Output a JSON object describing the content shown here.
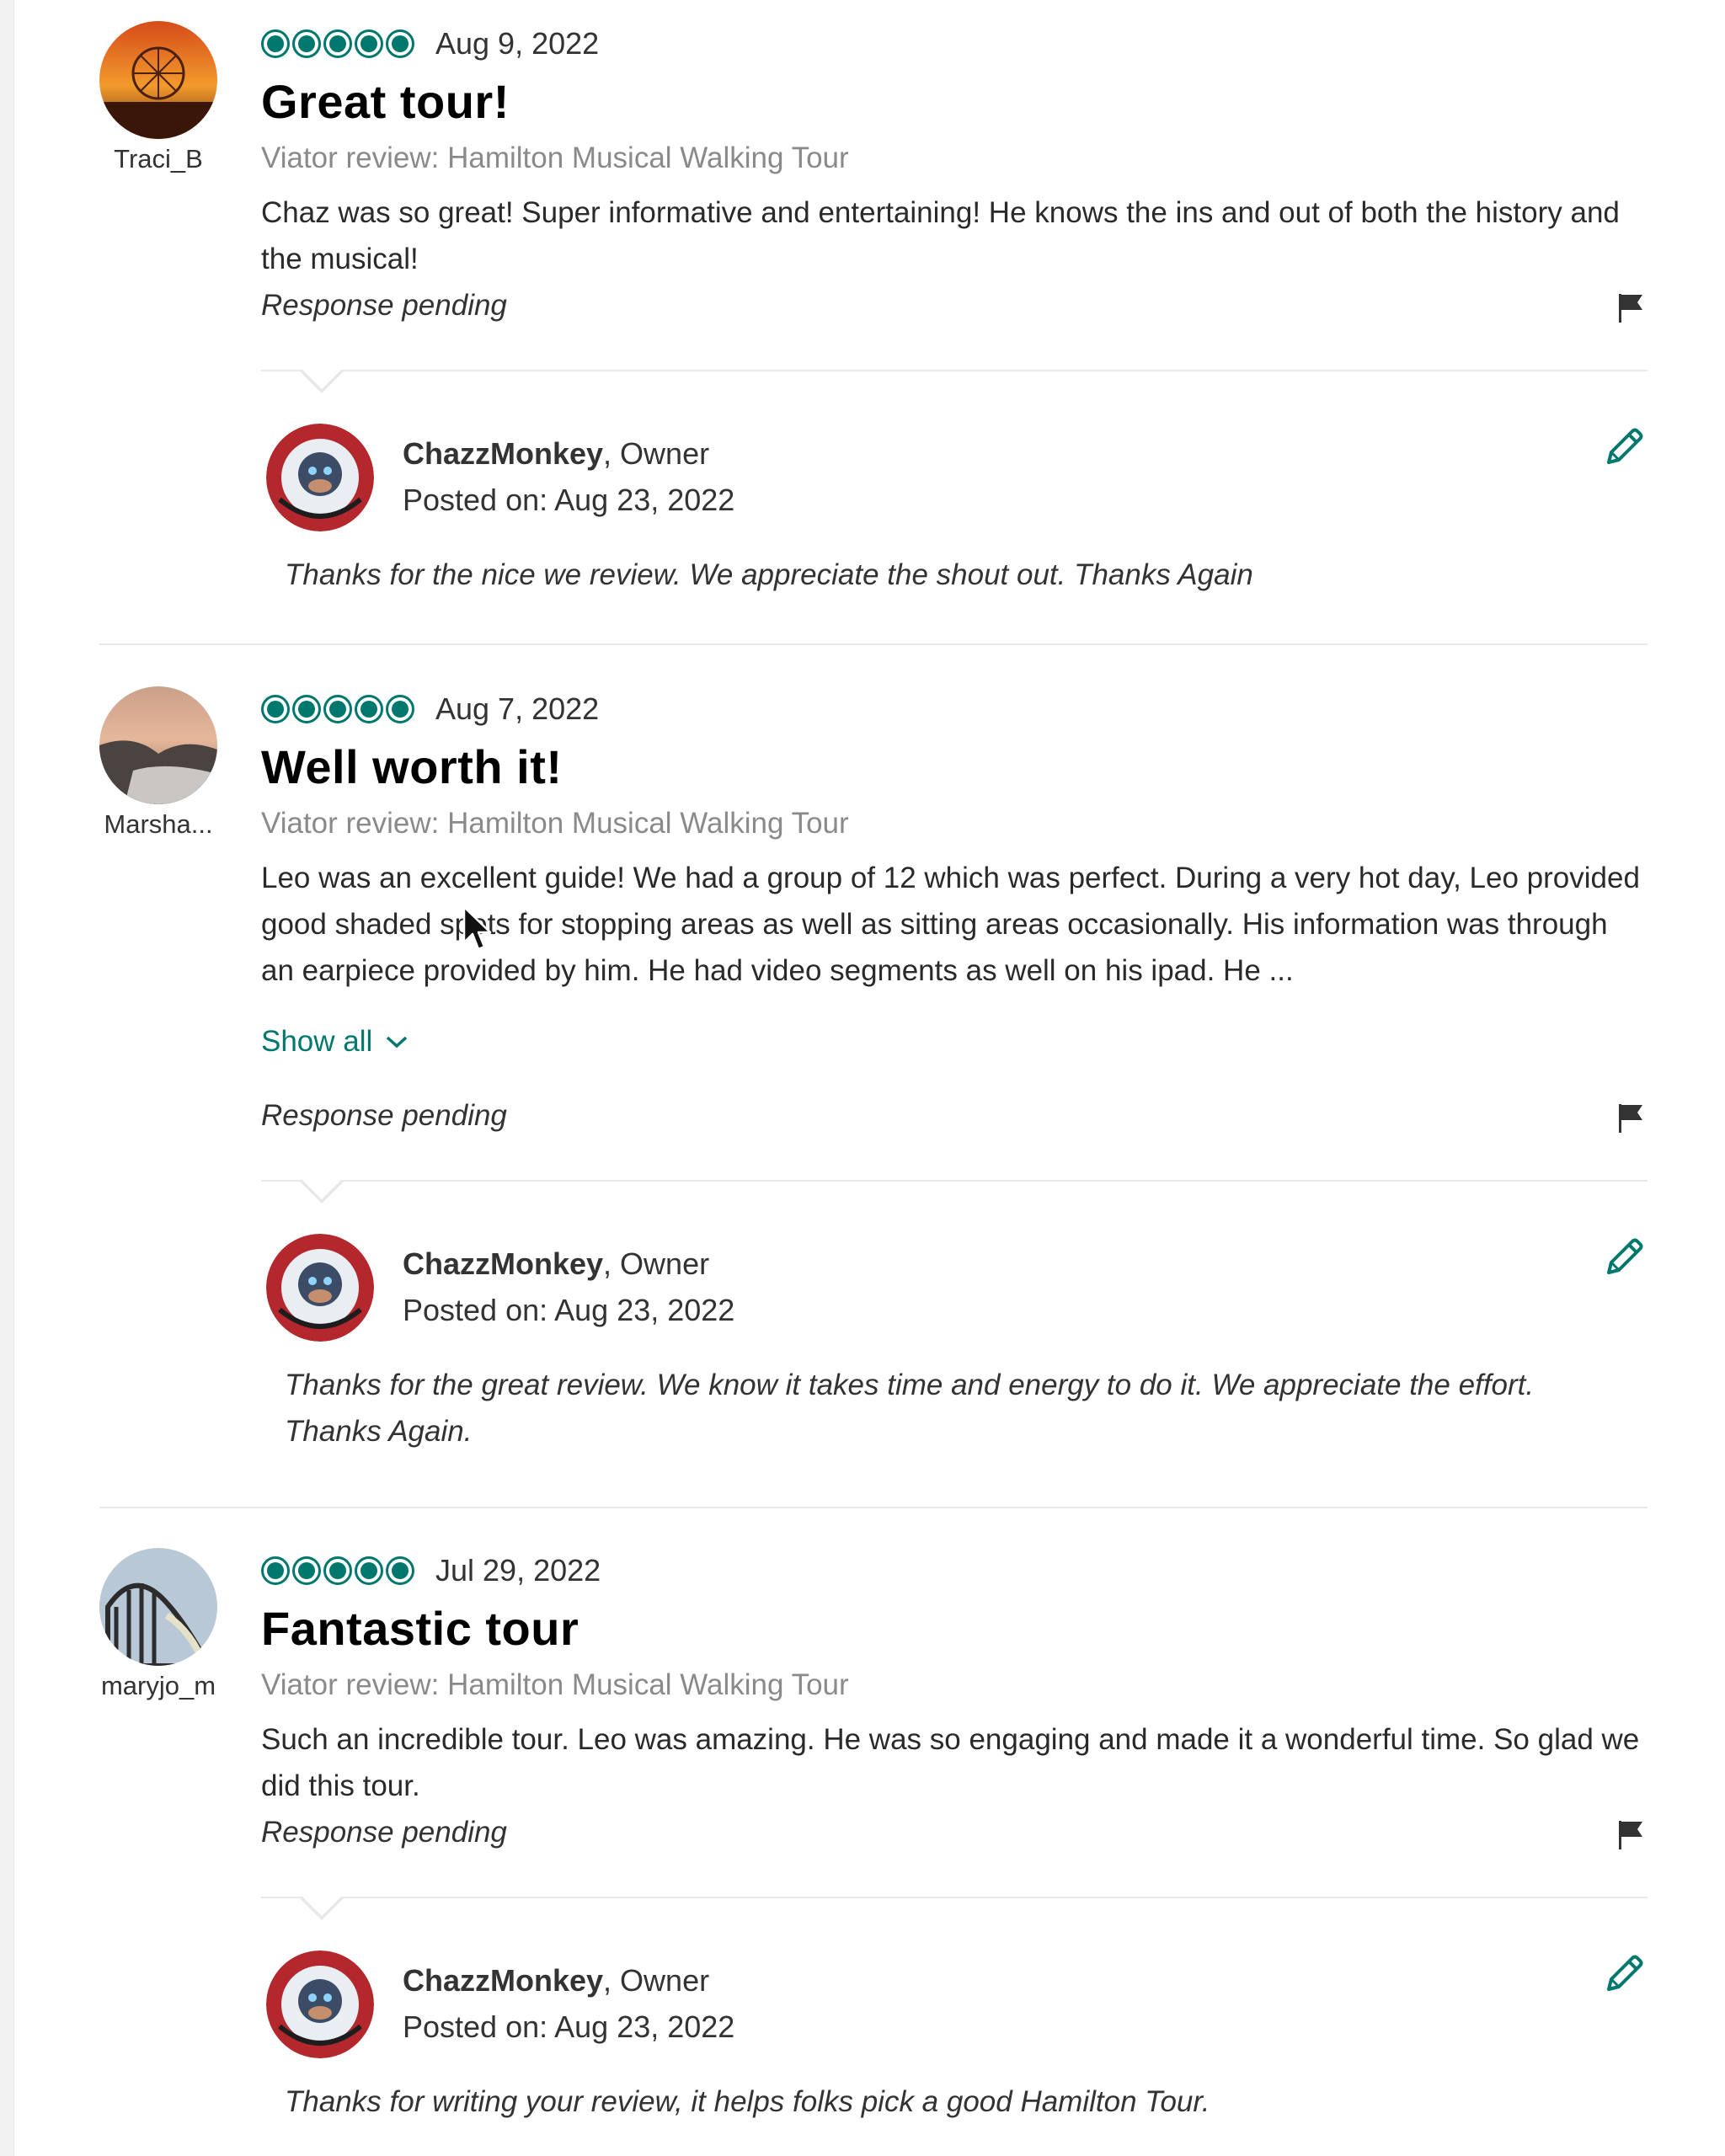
{
  "reviews": [
    {
      "reviewer": "Traci_B",
      "date": "Aug 9, 2022",
      "title": "Great tour!",
      "source": "Viator review: Hamilton Musical Walking Tour",
      "text": "Chaz was so great! Super informative and entertaining! He knows the ins and out of both the history and the musical!",
      "show_all": "",
      "status": "Response pending",
      "response": {
        "owner": "ChazzMonkey",
        "role": ", Owner",
        "posted_label": "Posted on:",
        "posted_date": "Aug 23, 2022",
        "text": "Thanks for the nice we review. We appreciate the shout out. Thanks Again"
      }
    },
    {
      "reviewer": "Marsha...",
      "date": "Aug 7, 2022",
      "title": "Well worth it!",
      "source": "Viator review: Hamilton Musical Walking Tour",
      "text": "Leo was an excellent guide! We had a group of 12 which was perfect. During a very hot day, Leo provided good shaded spots for stopping areas as well as sitting areas occasionally. His information was through an earpiece provided by him. He had video segments as well on his ipad. He ...",
      "show_all": "Show all",
      "status": "Response pending",
      "response": {
        "owner": "ChazzMonkey",
        "role": ", Owner",
        "posted_label": "Posted on:",
        "posted_date": "Aug 23, 2022",
        "text": "Thanks for the great review. We know it takes time and energy to do it. We appreciate the effort. Thanks Again."
      }
    },
    {
      "reviewer": "maryjo_m",
      "date": "Jul 29, 2022",
      "title": "Fantastic tour",
      "source": "Viator review: Hamilton Musical Walking Tour",
      "text": "Such an incredible tour. Leo was amazing. He was so engaging and made it a wonderful time. So glad we did this tour.",
      "show_all": "",
      "status": "Response pending",
      "response": {
        "owner": "ChazzMonkey",
        "role": ", Owner",
        "posted_label": "Posted on:",
        "posted_date": "Aug 23, 2022",
        "text": "Thanks for writing your review, it helps folks pick a good Hamilton Tour."
      }
    }
  ],
  "rating": {
    "value": 5,
    "max": 5,
    "icon": "rating-bubble-icon"
  },
  "colors": {
    "accent": "#00786d",
    "muted_text": "#8a8a8a",
    "divider": "#e8e8e8"
  }
}
